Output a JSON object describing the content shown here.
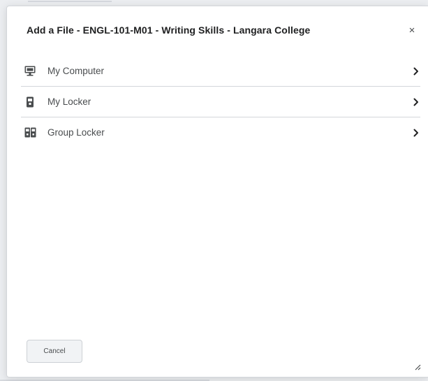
{
  "dialog": {
    "title": "Add a File - ENGL-101-M01 - Writing Skills - Langara College",
    "close_label": "×"
  },
  "sources": [
    {
      "label": "My Computer",
      "icon": "computer-icon"
    },
    {
      "label": "My Locker",
      "icon": "locker-icon"
    },
    {
      "label": "Group Locker",
      "icon": "group-locker-icon"
    }
  ],
  "footer": {
    "cancel_label": "Cancel"
  },
  "colors": {
    "title": "#202122",
    "text": "#494c4e",
    "divider": "#d3d6da",
    "button_bg": "#f1f3f5"
  }
}
